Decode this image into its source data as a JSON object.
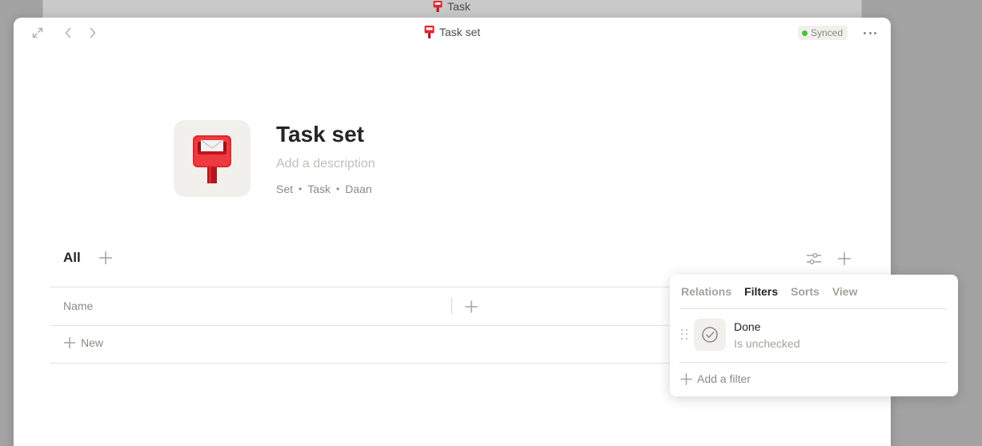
{
  "background_window": {
    "title": "Task"
  },
  "window": {
    "title": "Task set",
    "sync_status": "Synced",
    "colors": {
      "sync_dot": "#4dc13b",
      "accent_red": "#e3262e"
    }
  },
  "header": {
    "icon": "postbox-icon",
    "title": "Task set",
    "description_placeholder": "Add a description",
    "meta": [
      "Set",
      "Task",
      "Daan"
    ],
    "meta_separator": "•"
  },
  "views": {
    "tabs": [
      {
        "label": "All",
        "active": true
      }
    ]
  },
  "table": {
    "columns": [
      "Name"
    ],
    "new_row_label": "New"
  },
  "settings_popup": {
    "tabs": [
      {
        "label": "Relations",
        "active": false
      },
      {
        "label": "Filters",
        "active": true
      },
      {
        "label": "Sorts",
        "active": false
      },
      {
        "label": "View",
        "active": false
      }
    ],
    "filters": [
      {
        "icon": "checkbox-icon",
        "property": "Done",
        "condition": "Is unchecked"
      }
    ],
    "add_filter_label": "Add a filter"
  }
}
